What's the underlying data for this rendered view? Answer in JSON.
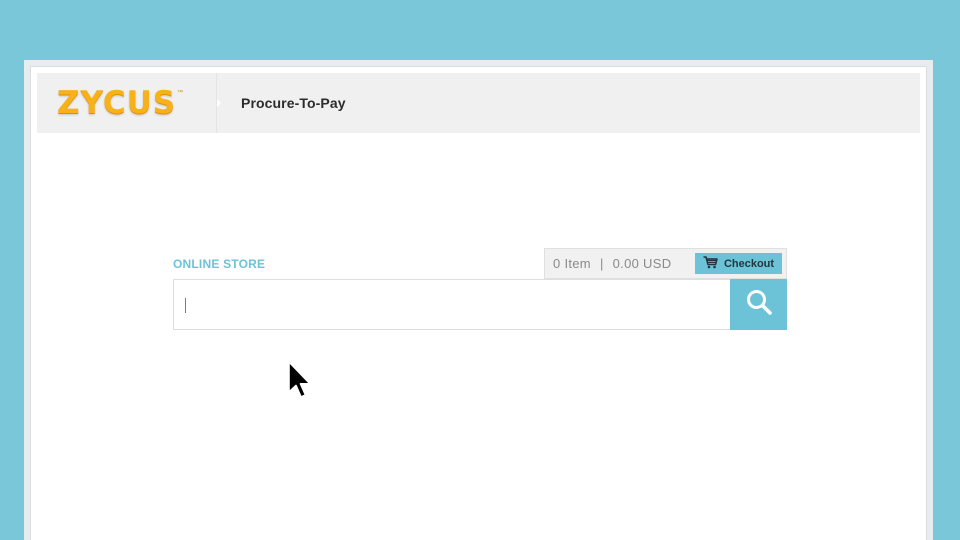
{
  "header": {
    "logo_text": "ZYCUS",
    "logo_tm": "™",
    "app_title": "Procure-To-Pay"
  },
  "store": {
    "label": "ONLINE STORE",
    "cart": {
      "items": "0 Item",
      "separator": "|",
      "total": "0.00 USD",
      "checkout_label": "Checkout"
    },
    "search": {
      "value": "",
      "placeholder": ""
    }
  },
  "icons": {
    "cart": "cart-icon",
    "search": "search-icon",
    "pointer": "mouse-pointer-icon"
  },
  "colors": {
    "background": "#7bc7da",
    "accent": "#6cc3d8",
    "logo": "#f7b21a",
    "header_bg": "#f0f0f0"
  }
}
